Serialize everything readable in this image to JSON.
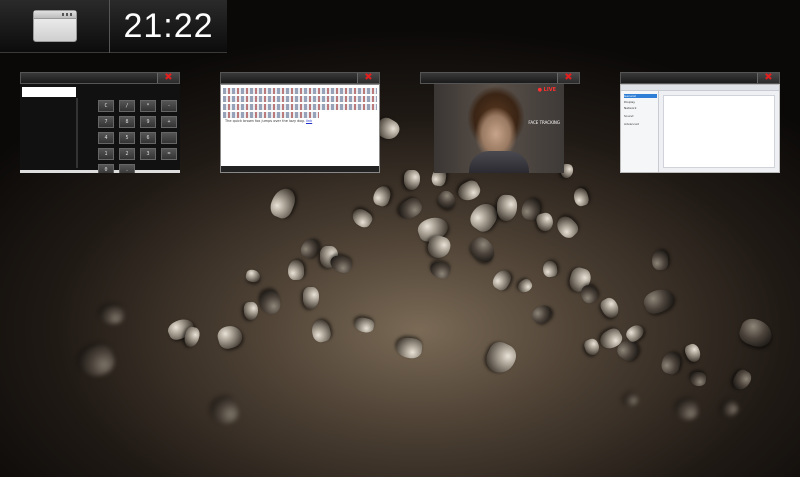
{
  "taskbar": {
    "switcher_icon": "window-icon",
    "clock": "21:22"
  },
  "windows": [
    {
      "id": "calculator",
      "close_label": "✖"
    },
    {
      "id": "text-editor",
      "close_label": "✖",
      "body_text": "The quick brown fox jumps over the lazy dog.",
      "link_text": "link"
    },
    {
      "id": "webcam",
      "close_label": "✖",
      "live_label": "● LIVE",
      "overlay_text": "FACE TRACKING"
    },
    {
      "id": "settings",
      "close_label": "✖",
      "items": [
        "General",
        "Display",
        "Network",
        "Sound",
        "Advanced"
      ]
    }
  ],
  "calculator": {
    "keys": [
      "C",
      "/",
      "*",
      "-",
      "7",
      "8",
      "9",
      "+",
      "4",
      "5",
      "6",
      "",
      "1",
      "2",
      "3",
      "=",
      "0",
      "."
    ]
  },
  "colors": {
    "close_icon": "#e02020",
    "clock_text": "#ffffff",
    "settings_selected": "#2f7fd6"
  }
}
